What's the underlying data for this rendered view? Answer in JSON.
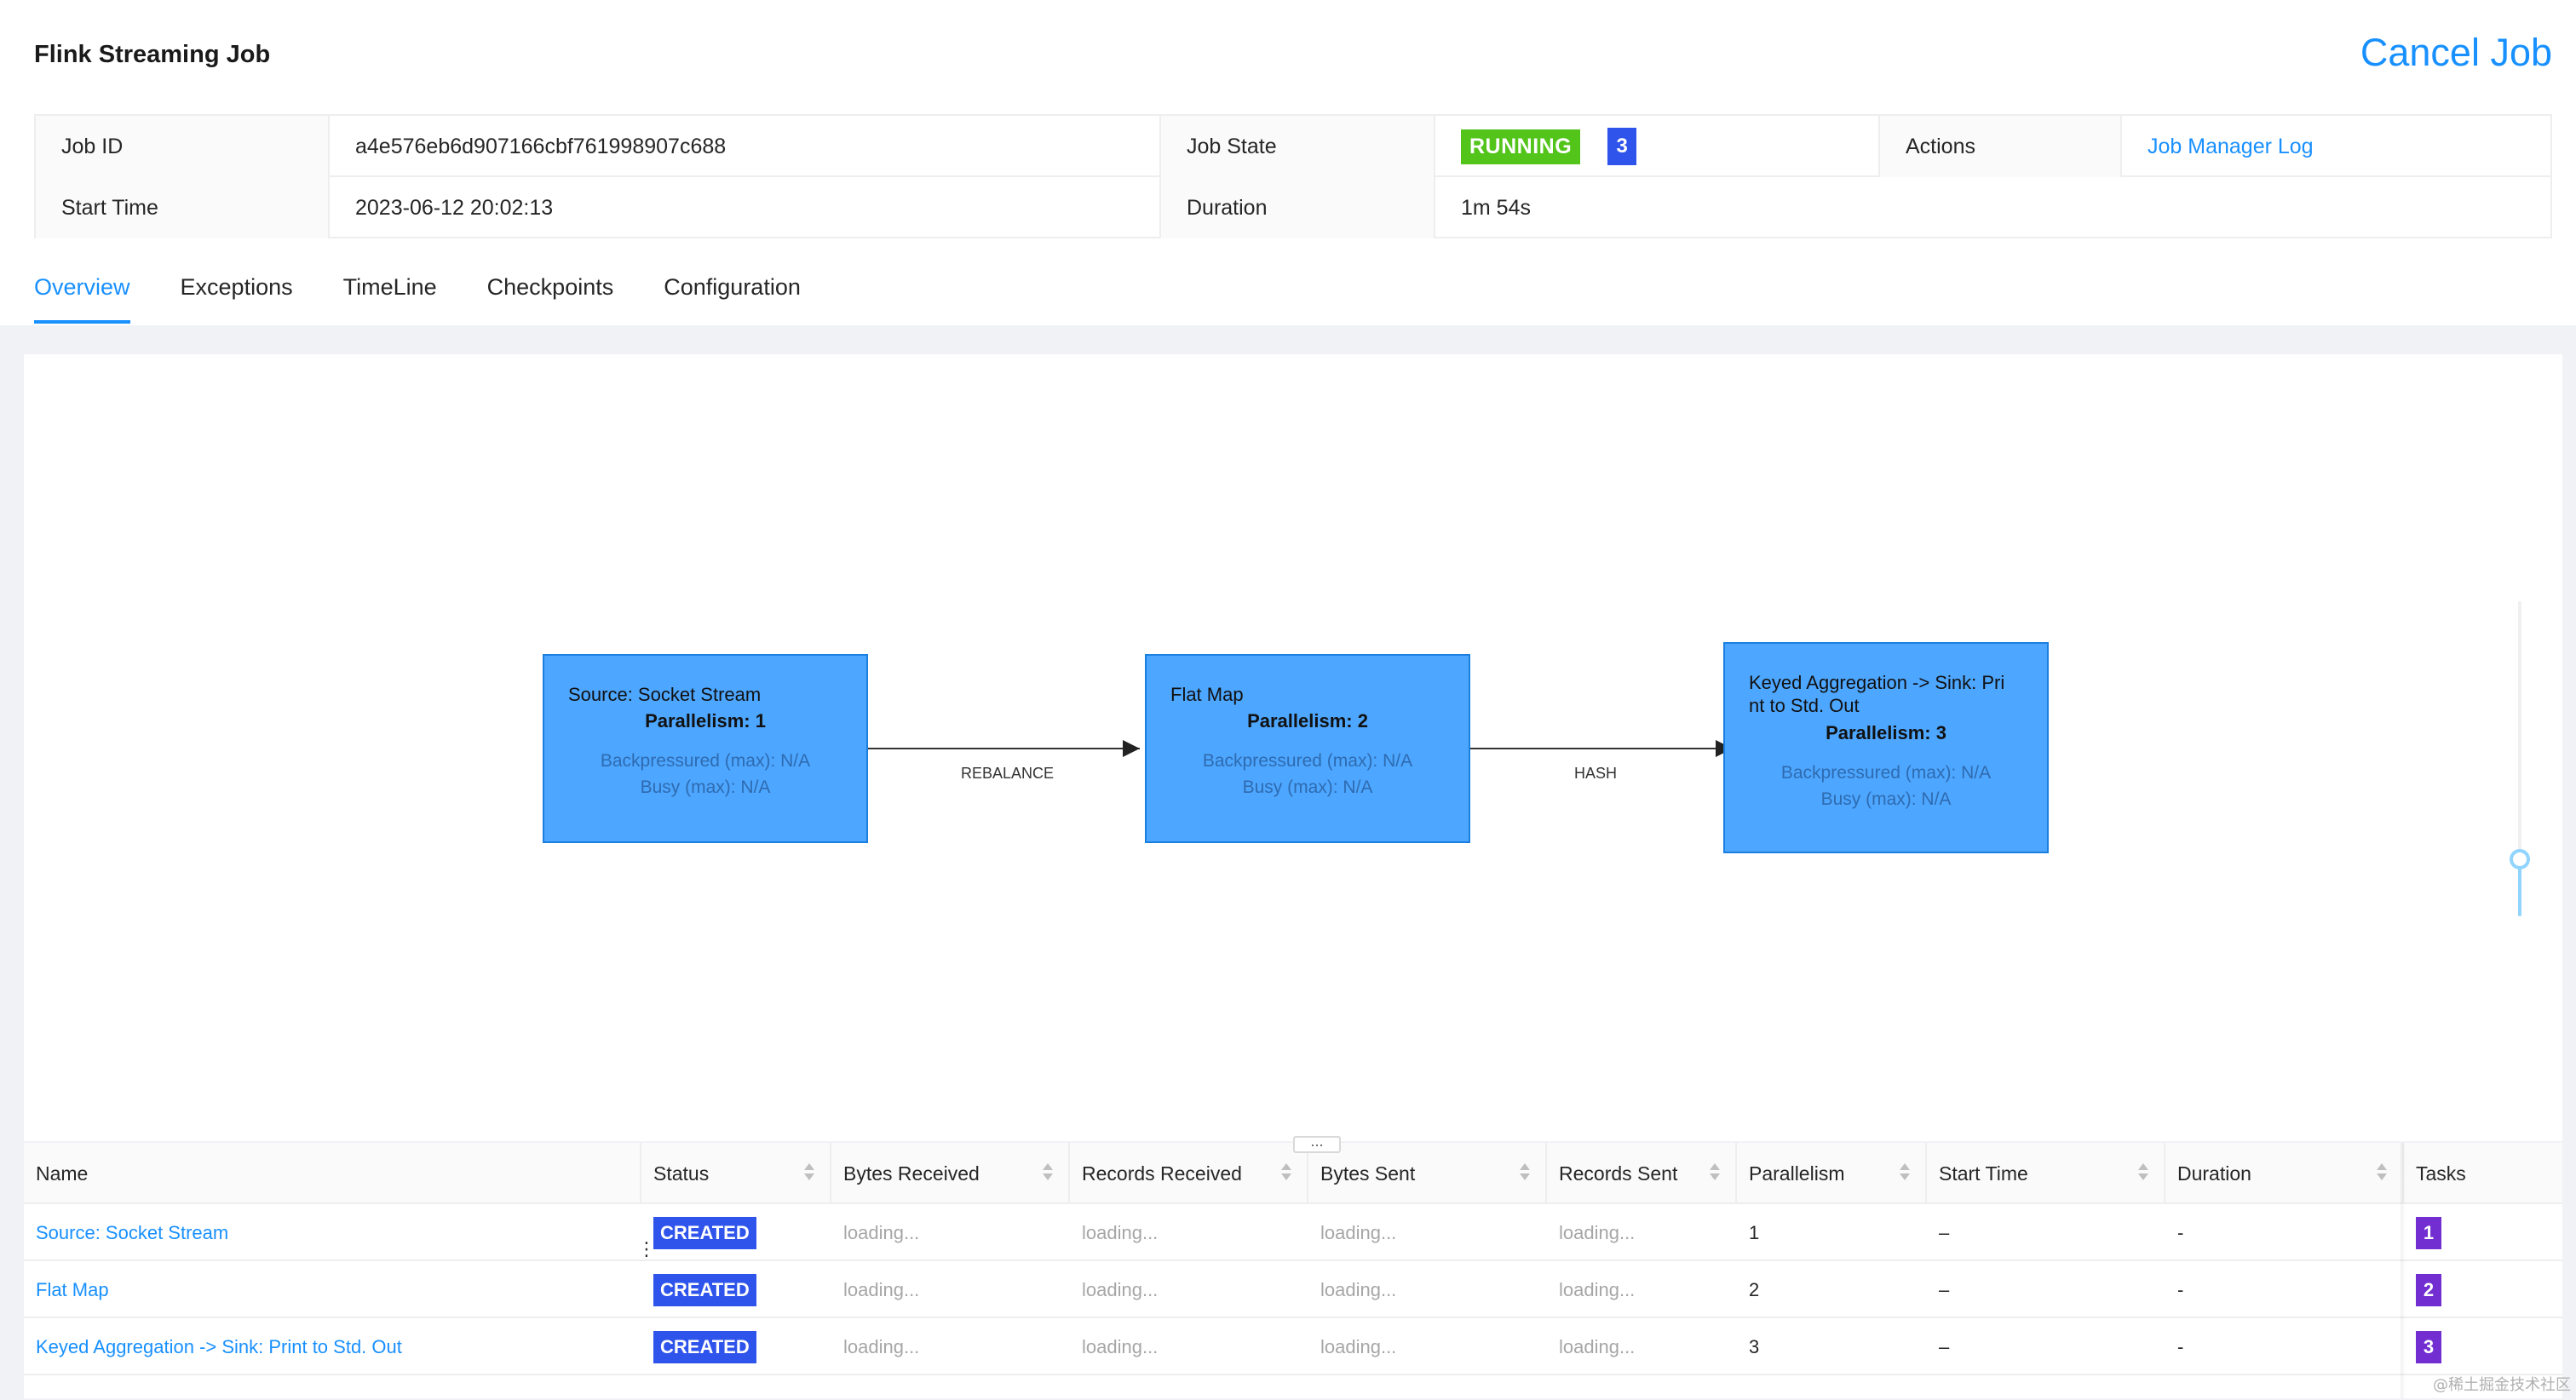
{
  "header": {
    "title": "Flink Streaming Job",
    "cancel_label": "Cancel Job"
  },
  "info": {
    "job_id_label": "Job ID",
    "job_id_value": "a4e576eb6d907166cbf761998907c688",
    "job_state_label": "Job State",
    "job_state_value": "RUNNING",
    "job_state_count": "3",
    "actions_label": "Actions",
    "actions_link": "Job Manager Log",
    "start_time_label": "Start Time",
    "start_time_value": "2023-06-12 20:02:13",
    "duration_label": "Duration",
    "duration_value": "1m 54s"
  },
  "tabs": [
    {
      "label": "Overview",
      "active": true
    },
    {
      "label": "Exceptions"
    },
    {
      "label": "TimeLine"
    },
    {
      "label": "Checkpoints"
    },
    {
      "label": "Configuration"
    }
  ],
  "graph": {
    "nodes": [
      {
        "title": "Source: Socket Stream",
        "parallelism": "Parallelism: 1",
        "backpressured": "Backpressured (max): N/A",
        "busy": "Busy (max): N/A"
      },
      {
        "title": "Flat Map",
        "parallelism": "Parallelism: 2",
        "backpressured": "Backpressured (max): N/A",
        "busy": "Busy (max): N/A"
      },
      {
        "title_line1": "Keyed Aggregation -> Sink: Pri",
        "title_line2": "nt to Std. Out",
        "parallelism": "Parallelism: 3",
        "backpressured": "Backpressured (max): N/A",
        "busy": "Busy (max): N/A"
      }
    ],
    "edges": [
      {
        "label": "REBALANCE"
      },
      {
        "label": "HASH"
      }
    ],
    "zoom_level": 0.18
  },
  "table": {
    "drag_handle": "...",
    "columns": [
      "Name",
      "Status",
      "Bytes Received",
      "Records Received",
      "Bytes Sent",
      "Records Sent",
      "Parallelism",
      "Start Time",
      "Duration",
      "Tasks"
    ],
    "rows": [
      {
        "name": "Source: Socket Stream",
        "status": "CREATED",
        "bytes_received": "loading...",
        "records_received": "loading...",
        "bytes_sent": "loading...",
        "records_sent": "loading...",
        "parallelism": "1",
        "start_time": "–",
        "duration": "-",
        "tasks": "1"
      },
      {
        "name": "Flat Map",
        "status": "CREATED",
        "bytes_received": "loading...",
        "records_received": "loading...",
        "bytes_sent": "loading...",
        "records_sent": "loading...",
        "parallelism": "2",
        "start_time": "–",
        "duration": "-",
        "tasks": "2"
      },
      {
        "name": "Keyed Aggregation -> Sink: Print to Std. Out",
        "status": "CREATED",
        "bytes_received": "loading...",
        "records_received": "loading...",
        "bytes_sent": "loading...",
        "records_sent": "loading...",
        "parallelism": "3",
        "start_time": "–",
        "duration": "-",
        "tasks": "3"
      }
    ]
  },
  "watermark": "@稀土掘金技术社区",
  "colors": {
    "accent": "#1890ff",
    "running": "#52c41a",
    "created": "#2f54eb",
    "task_badge": "#722ed1",
    "node_fill": "#4da6ff"
  }
}
